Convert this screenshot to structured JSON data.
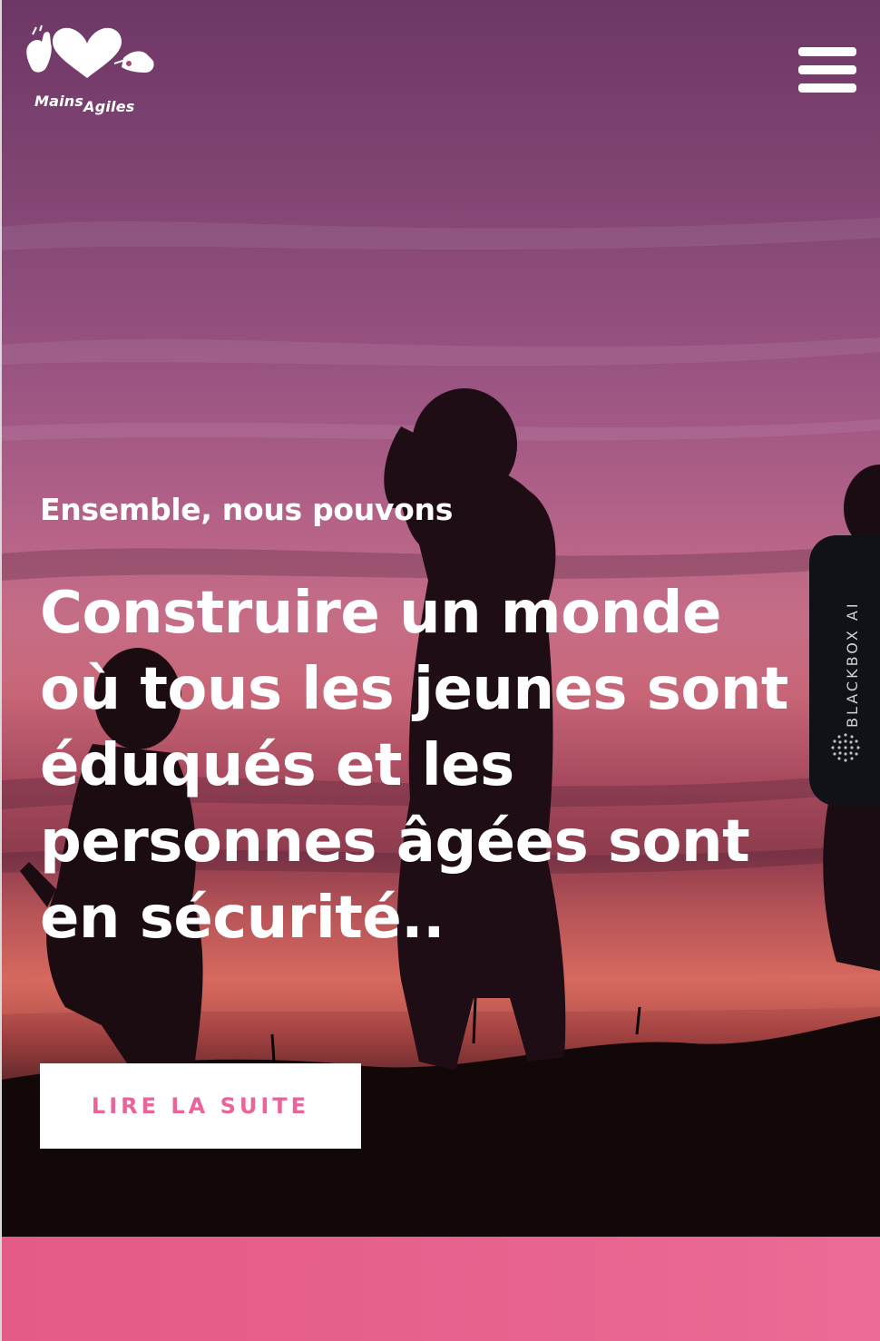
{
  "brand": {
    "name_main": "Mains",
    "name_sub": "Agiles",
    "logo_icon": "heart-with-hands-icon"
  },
  "header": {
    "menu_icon": "hamburger-menu-icon"
  },
  "hero": {
    "kicker": "Ensemble, nous pouvons",
    "headline": "Construire un monde où tous les jeunes sont éduqués et les personnes âgées sont en sécurité..",
    "cta_label": "LIRE LA SUITE",
    "background_image": "silhouettes-children-sunset-photo"
  },
  "widget": {
    "label": "BLACKBOX AI",
    "icon": "dotted-circle-icon"
  },
  "colors": {
    "accent_pink": "#e8649a",
    "band_pink": "#e35b86",
    "widget_bg": "#101217",
    "text_white": "#ffffff"
  }
}
